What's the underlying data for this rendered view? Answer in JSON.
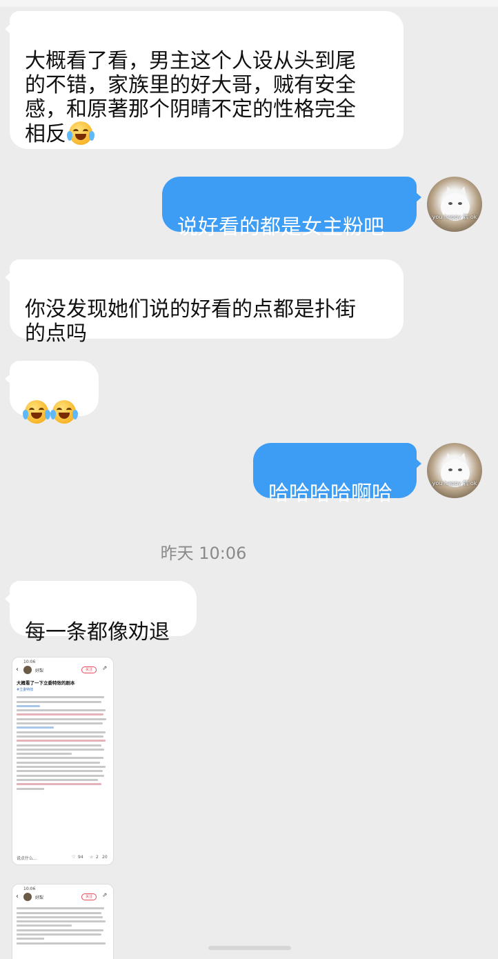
{
  "messages": {
    "m1": "大概看了看，男主这个人设从头到尾\n的不错，家族里的好大哥，贼有安全\n感，和原著那个阴晴不定的性格完全\n相反",
    "m2": "说好看的都是女主粉吧",
    "m3": "你没发现她们说的好看的点都是扑街\n的点吗",
    "m5": "哈哈哈哈啊哈",
    "m6": "每一条都像劝退"
  },
  "emoji_names": [
    "laughing-tears-emoji",
    "crying-emoji"
  ],
  "timestamp": "昨天 10:06",
  "avatar": {
    "caption": "you happy 就 ok"
  },
  "screenshot_thumb": {
    "clock": "10:06",
    "username": "好梨",
    "follow_label": "关注",
    "title": "大概看了一下立委特效的剧本",
    "tag": "#立委特效",
    "comment_placeholder": "说点什么...",
    "likes": "94",
    "stars": "2",
    "comments": "20"
  },
  "colors": {
    "background": "#ececec",
    "incoming_bubble": "#ffffff",
    "outgoing_bubble": "#3d9df4",
    "timestamp_text": "#8a8a8a"
  }
}
